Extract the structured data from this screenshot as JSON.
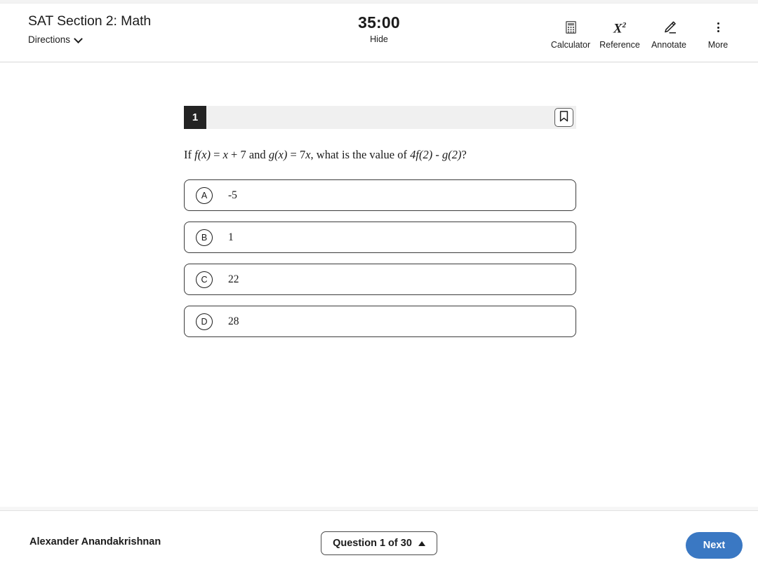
{
  "header": {
    "section_title": "SAT Section 2: Math",
    "directions_label": "Directions",
    "directions_icon": "chevron-down-icon",
    "timer": "35:00",
    "hide_label": "Hide",
    "tools": [
      {
        "label": "Calculator",
        "icon": "calculator-icon"
      },
      {
        "label": "Reference",
        "icon": "x-squared-icon",
        "glyph_base": "X",
        "glyph_sup": "2"
      },
      {
        "label": "Annotate",
        "icon": "pencil-annotate-icon"
      },
      {
        "label": "More",
        "icon": "more-vertical-icon"
      }
    ]
  },
  "question": {
    "number": "1",
    "bookmark_icon": "bookmark-icon",
    "text_parts": {
      "p1": "If ",
      "m1": "f(x)",
      "p2": " = ",
      "m2": "x",
      "p3": " + 7 and ",
      "m3": "g(x)",
      "p4": " = 7",
      "m4": "x",
      "p5": ", what is the value of ",
      "m5": "4f(2) - g(2)",
      "p6": "?"
    },
    "choices": [
      {
        "letter": "A",
        "text": "-5"
      },
      {
        "letter": "B",
        "text": "1"
      },
      {
        "letter": "C",
        "text": "22"
      },
      {
        "letter": "D",
        "text": "28"
      }
    ]
  },
  "footer": {
    "student_name": "Alexander Anandakrishnan",
    "question_nav_label": "Question 1 of 30",
    "question_nav_icon": "caret-up-icon",
    "next_label": "Next"
  },
  "colors": {
    "accent_blue": "#3a78c3",
    "question_badge": "#232323",
    "question_bar": "#f0f0f0"
  }
}
